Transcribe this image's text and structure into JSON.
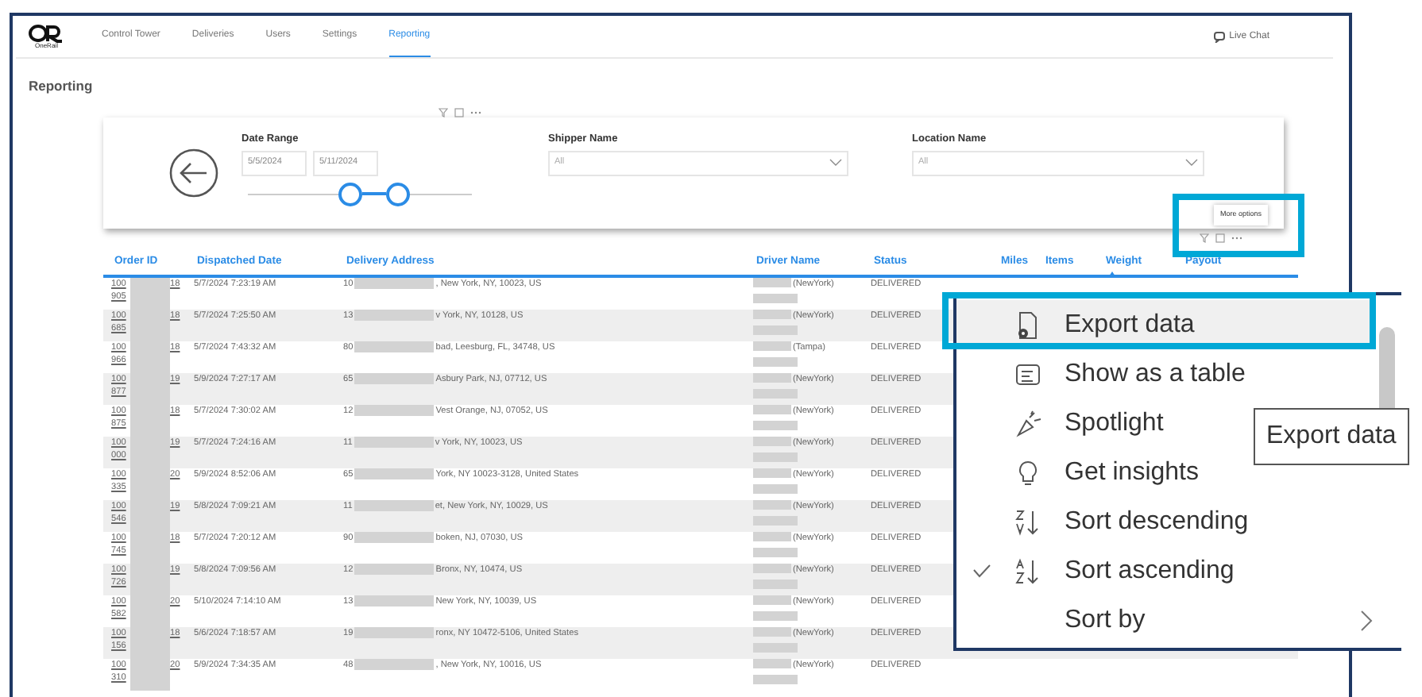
{
  "app": {
    "logo_text": "OneRail",
    "nav": [
      {
        "label": "Control Tower",
        "selected": false
      },
      {
        "label": "Deliveries",
        "selected": false
      },
      {
        "label": "Users",
        "selected": false
      },
      {
        "label": "Settings",
        "selected": false
      },
      {
        "label": "Reporting",
        "selected": true
      }
    ],
    "live_chat": "Live Chat"
  },
  "page_title": "Reporting",
  "filters": {
    "date_range": {
      "label": "Date Range",
      "start": "5/5/2024",
      "end": "5/11/2024",
      "slider": {
        "low": {
          "level": 0.46
        },
        "high": {
          "level": 0.67
        }
      }
    },
    "shipper": {
      "label": "Shipper Name",
      "placeholder": "All"
    },
    "location": {
      "label": "Location Name",
      "placeholder": "All"
    }
  },
  "table_toolbar": {
    "highlighted": true,
    "tooltip": "More options"
  },
  "table": {
    "columns": [
      {
        "label": "Order ID",
        "sorted": false
      },
      {
        "label": "Dispatched Date",
        "sorted": false
      },
      {
        "label": "Delivery Address",
        "sorted": false
      },
      {
        "label": "Driver Name",
        "sorted": false
      },
      {
        "label": "Status",
        "sorted": false
      },
      {
        "label": "Miles",
        "sorted": false
      },
      {
        "label": "Items",
        "sorted": false
      },
      {
        "label": "Weight",
        "sorted": true
      },
      {
        "label": "Payout",
        "sorted": false
      }
    ],
    "rows": [
      {
        "id_start": "100",
        "id_end": "18",
        "id_line2": "905",
        "dispatched": "5/7/2024 7:23:19 AM",
        "address_start": "10",
        "address_end": ", New York, NY, 10023, US",
        "driver_city": "(NewYork)",
        "status": "DELIVERED"
      },
      {
        "id_start": "100",
        "id_end": "18",
        "id_line2": "685",
        "dispatched": "5/7/2024 7:25:50 AM",
        "address_start": "13",
        "address_end": "v York, NY, 10128, US",
        "driver_city": "(NewYork)",
        "status": "DELIVERED"
      },
      {
        "id_start": "100",
        "id_end": "18",
        "id_line2": "966",
        "dispatched": "5/7/2024 7:43:32 AM",
        "address_start": "80",
        "address_end": "bad, Leesburg, FL, 34748, US",
        "driver_city": "(Tampa)",
        "status": "DELIVERED"
      },
      {
        "id_start": "100",
        "id_end": "19",
        "id_line2": "877",
        "dispatched": "5/9/2024 7:27:17 AM",
        "address_start": "65",
        "address_end": "Asbury Park, NJ, 07712, US",
        "driver_city": "(NewYork)",
        "status": "DELIVERED"
      },
      {
        "id_start": "100",
        "id_end": "18",
        "id_line2": "875",
        "dispatched": "5/7/2024 7:30:02 AM",
        "address_start": "12",
        "address_end": "Vest Orange, NJ, 07052, US",
        "driver_city": "(NewYork)",
        "status": "DELIVERED"
      },
      {
        "id_start": "100",
        "id_end": "19",
        "id_line2": "000",
        "dispatched": "5/7/2024 7:24:16 AM",
        "address_start": "11",
        "address_end": "v York, NY, 10023, US",
        "driver_city": "(NewYork)",
        "status": "DELIVERED"
      },
      {
        "id_start": "100",
        "id_end": "20",
        "id_line2": "335",
        "dispatched": "5/9/2024 8:52:06 AM",
        "address_start": "65",
        "address_end": "York, NY 10023-3128, United States",
        "driver_city": "(NewYork)",
        "status": "DELIVERED"
      },
      {
        "id_start": "100",
        "id_end": "19",
        "id_line2": "546",
        "dispatched": "5/8/2024 7:09:21 AM",
        "address_start": "11",
        "address_end": "et, New York, NY, 10029, US",
        "driver_city": "(NewYork)",
        "status": "DELIVERED"
      },
      {
        "id_start": "100",
        "id_end": "18",
        "id_line2": "745",
        "dispatched": "5/7/2024 7:20:12 AM",
        "address_start": "90",
        "address_end": "boken, NJ, 07030, US",
        "driver_city": "(NewYork)",
        "status": "DELIVERED"
      },
      {
        "id_start": "100",
        "id_end": "19",
        "id_line2": "726",
        "dispatched": "5/8/2024 7:09:56 AM",
        "address_start": "12",
        "address_end": "Bronx, NY, 10474, US",
        "driver_city": "(NewYork)",
        "status": "DELIVERED"
      },
      {
        "id_start": "100",
        "id_end": "20",
        "id_line2": "582",
        "dispatched": "5/10/2024 7:14:10 AM",
        "address_start": "13",
        "address_end": "New York, NY, 10039, US",
        "driver_city": "(NewYork)",
        "status": "DELIVERED"
      },
      {
        "id_start": "100",
        "id_end": "18",
        "id_line2": "156",
        "dispatched": "5/6/2024 7:18:57 AM",
        "address_start": "19",
        "address_end": "ronx, NY 10472-5106, United States",
        "driver_city": "(NewYork)",
        "status": "DELIVERED"
      },
      {
        "id_start": "100",
        "id_end": "20",
        "id_line2": "310",
        "dispatched": "5/9/2024 7:34:35 AM",
        "address_start": "48",
        "address_end": ", New York, NY, 10016, US",
        "driver_city": "(NewYork)",
        "status": "DELIVERED"
      }
    ]
  },
  "context_menu": {
    "items": [
      {
        "label": "Export data",
        "kind": "export",
        "highlighted": true,
        "checked": false
      },
      {
        "label": "Show as a table",
        "kind": "table",
        "highlighted": false,
        "checked": false
      },
      {
        "label": "Spotlight",
        "kind": "spotlight",
        "highlighted": false,
        "checked": false
      },
      {
        "label": "Get insights",
        "kind": "insights",
        "highlighted": false,
        "checked": false
      },
      {
        "label": "Sort descending",
        "kind": "sort-desc",
        "highlighted": false,
        "checked": false
      },
      {
        "label": "Sort ascending",
        "kind": "sort-asc",
        "highlighted": false,
        "checked": true
      },
      {
        "label": "Sort by",
        "kind": "submenu",
        "highlighted": false,
        "checked": false
      }
    ]
  },
  "tooltip": {
    "text": "Export data"
  }
}
